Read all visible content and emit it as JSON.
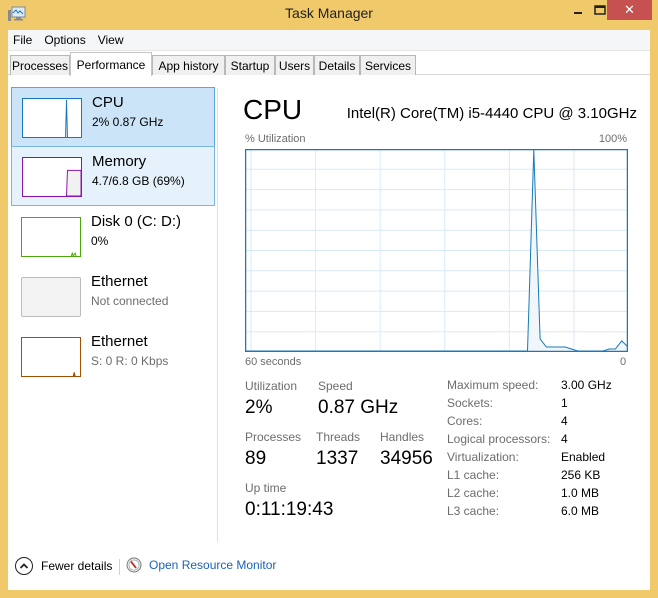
{
  "window": {
    "title": "Task Manager",
    "app_icon": "task-manager-icon",
    "controls": {
      "minimize": "–",
      "maximize": "□",
      "close": "✕"
    }
  },
  "menu": [
    "File",
    "Options",
    "View"
  ],
  "tabs": [
    {
      "label": "Processes",
      "active": false
    },
    {
      "label": "Performance",
      "active": true
    },
    {
      "label": "App history",
      "active": false
    },
    {
      "label": "Startup",
      "active": false
    },
    {
      "label": "Users",
      "active": false
    },
    {
      "label": "Details",
      "active": false
    },
    {
      "label": "Services",
      "active": false
    }
  ],
  "sidebar": {
    "items": [
      {
        "title": "CPU",
        "subtitle": "2% 0.87 GHz",
        "color": "#1779ba",
        "state": "selected"
      },
      {
        "title": "Memory",
        "subtitle": "4.7/6.8 GB (69%)",
        "color": "#8b12ae",
        "state": "hover",
        "usage_percent": 69
      },
      {
        "title": "Disk 0 (C: D:)",
        "subtitle": "0%",
        "color": "#4da60c",
        "state": "normal"
      },
      {
        "title": "Ethernet",
        "subtitle": "Not connected",
        "color": "#bcbcbc",
        "state": "disabled"
      },
      {
        "title": "Ethernet",
        "subtitle": "S: 0 R: 0 Kbps",
        "color": "#a74f01",
        "state": "normal"
      }
    ]
  },
  "main": {
    "title": "CPU",
    "cpu_model": "Intel(R) Core(TM) i5-4440 CPU @ 3.10GHz",
    "graph": {
      "ylabel": "% Utilization",
      "ymax_label": "100%",
      "xlabel_left": "60 seconds",
      "xlabel_right": "0",
      "line_color": "#1779ba",
      "grid_color": "#d9eaf7"
    },
    "stats": {
      "utilization": {
        "label": "Utilization",
        "value": "2%"
      },
      "speed": {
        "label": "Speed",
        "value": "0.87 GHz"
      },
      "processes": {
        "label": "Processes",
        "value": "89"
      },
      "threads": {
        "label": "Threads",
        "value": "1337"
      },
      "handles": {
        "label": "Handles",
        "value": "34956"
      },
      "uptime": {
        "label": "Up time",
        "value": "0:11:19:43"
      }
    },
    "specs": [
      {
        "label": "Maximum speed:",
        "value": "3.00 GHz"
      },
      {
        "label": "Sockets:",
        "value": "1"
      },
      {
        "label": "Cores:",
        "value": "4"
      },
      {
        "label": "Logical processors:",
        "value": "4"
      },
      {
        "label": "Virtualization:",
        "value": "Enabled"
      },
      {
        "label": "L1 cache:",
        "value": "256 KB"
      },
      {
        "label": "L2 cache:",
        "value": "1.0 MB"
      },
      {
        "label": "L3 cache:",
        "value": "6.0 MB"
      }
    ]
  },
  "footer": {
    "fewer_details": "Fewer details",
    "open_resource_monitor": "Open Resource Monitor"
  },
  "chart_data": {
    "type": "area",
    "title": "CPU % Utilization",
    "xlabel": "60 seconds",
    "ylabel": "% Utilization",
    "ylim": [
      0,
      100
    ],
    "xlim": [
      60,
      0
    ],
    "grid": true,
    "series": [
      {
        "name": "CPU",
        "values": [
          0,
          0,
          0,
          0,
          0,
          0,
          0,
          0,
          0,
          0,
          0,
          0,
          0,
          0,
          0,
          0,
          0,
          0,
          0,
          0,
          0,
          0,
          0,
          0,
          0,
          0,
          0,
          0,
          0,
          0,
          0,
          0,
          0,
          0,
          0,
          0,
          0,
          0,
          0,
          0,
          0,
          0,
          0,
          0,
          0,
          0,
          100,
          6,
          2,
          2,
          2,
          2,
          1,
          0,
          0,
          0,
          0,
          0,
          1,
          1,
          5,
          2
        ]
      }
    ]
  }
}
